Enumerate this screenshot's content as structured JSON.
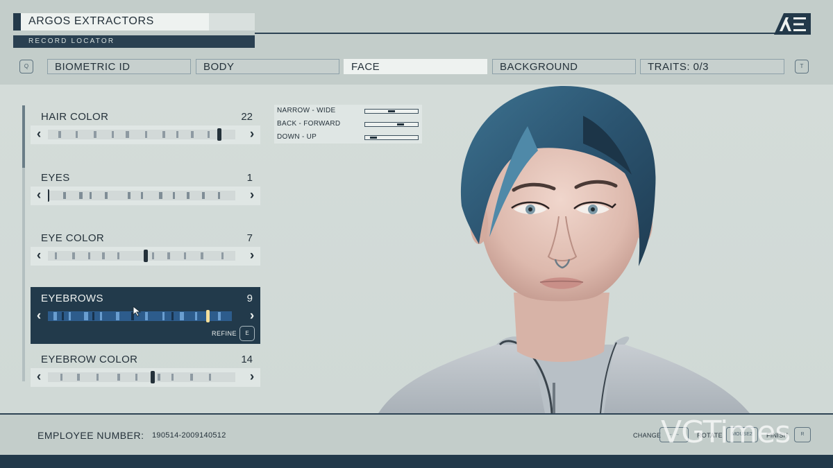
{
  "header": {
    "title": "ARGOS EXTRACTORS",
    "subtitle": "RECORD LOCATOR",
    "logo": "AE",
    "left_key": "Q",
    "right_key": "T",
    "tabs": [
      {
        "label": "BIOMETRIC ID",
        "active": false
      },
      {
        "label": "BODY",
        "active": false
      },
      {
        "label": "FACE",
        "active": true
      },
      {
        "label": "BACKGROUND",
        "active": false
      },
      {
        "label": "TRAITS: 0/3",
        "active": false
      }
    ]
  },
  "options": [
    {
      "label": "HAIR COLOR",
      "value": "22",
      "selected": false
    },
    {
      "label": "EYES",
      "value": "1",
      "selected": false
    },
    {
      "label": "EYE COLOR",
      "value": "7",
      "selected": false
    },
    {
      "label": "EYEBROWS",
      "value": "9",
      "selected": true,
      "refine_label": "REFINE",
      "refine_key": "E"
    },
    {
      "label": "EYEBROW COLOR",
      "value": "14",
      "selected": false
    }
  ],
  "sub_sliders": [
    {
      "label": "NARROW - WIDE",
      "level": 0.5
    },
    {
      "label": "BACK - FORWARD",
      "level": 0.7
    },
    {
      "label": "DOWN - UP",
      "level": 0.1
    }
  ],
  "footer": {
    "employee_label": "EMPLOYEE NUMBER:",
    "employee_number": "190514-2009140512",
    "controls": [
      {
        "label": "CHANGE",
        "key": "← →"
      },
      {
        "label": "ROTATE",
        "key": "MOUSE2"
      },
      {
        "label": "FINISH",
        "key": "R"
      }
    ],
    "watermark": "VGTimes"
  },
  "colors": {
    "accent_dark": "#223a4b",
    "panel_light": "#dfe6e4",
    "background": "#d0d9d6",
    "hair": "#2f5b78"
  },
  "icons": [
    "chevron-left-icon",
    "chevron-right-icon",
    "mouse-cursor-icon",
    "ae-logo-icon"
  ]
}
